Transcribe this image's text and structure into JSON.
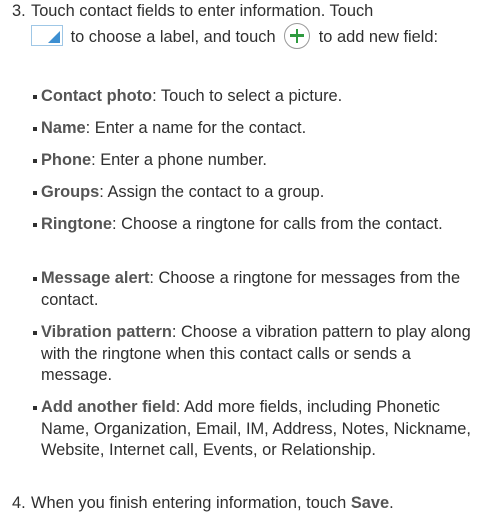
{
  "step3": {
    "number": "3.",
    "text_a": "Touch contact fields to enter information. Touch",
    "text_b": "to choose a label, and touch",
    "text_c": "to add new field:"
  },
  "bullets": [
    {
      "term": "Contact photo",
      "desc": ": Touch to select a picture."
    },
    {
      "term": "Name",
      "desc": ": Enter a name for the contact."
    },
    {
      "term": "Phone",
      "desc": ": Enter a phone number."
    },
    {
      "term": "Groups",
      "desc": ": Assign the contact to a group."
    },
    {
      "term": "Ringtone",
      "desc": ": Choose a ringtone for calls from the contact."
    },
    {
      "term": "Message alert",
      "desc": ": Choose a ringtone for messages from the contact."
    },
    {
      "term": "Vibration pattern",
      "desc": ": Choose a vibration pattern to play along with the ringtone when this contact calls or sends a message."
    },
    {
      "term": "Add another field",
      "desc": ": Add more fields, including Phonetic Name, Organization, Email, IM, Address, Notes, Nickname, Website, Internet call, Events, or Relationship."
    }
  ],
  "step4": {
    "number": "4.",
    "text": "When you finish entering information, touch",
    "save": "Save",
    "end": "."
  },
  "icons": {
    "label_icon": "label-selector-icon",
    "add_icon": "add-field-icon",
    "accent": "#2f9a3f",
    "label_blue": "#3d8fd1"
  }
}
